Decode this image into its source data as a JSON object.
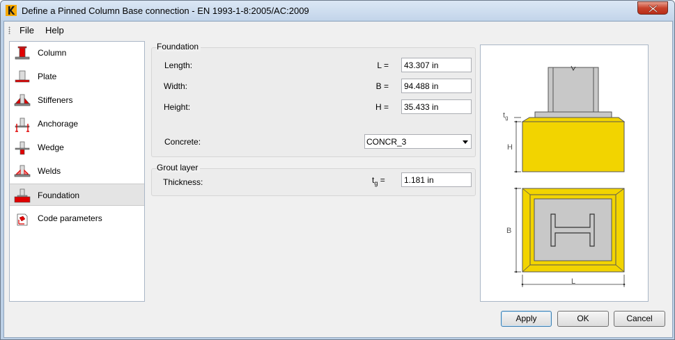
{
  "window": {
    "title": "Define a Pinned Column Base connection - EN 1993-1-8:2005/AC:2009"
  },
  "menu": {
    "items": [
      {
        "label": "File"
      },
      {
        "label": "Help"
      }
    ]
  },
  "sidebar": {
    "items": [
      {
        "label": "Column",
        "icon": "column-icon",
        "active": false
      },
      {
        "label": "Plate",
        "icon": "plate-icon",
        "active": false
      },
      {
        "label": "Stiffeners",
        "icon": "stiffeners-icon",
        "active": false
      },
      {
        "label": "Anchorage",
        "icon": "anchorage-icon",
        "active": false
      },
      {
        "label": "Wedge",
        "icon": "wedge-icon",
        "active": false
      },
      {
        "label": "Welds",
        "icon": "welds-icon",
        "active": false
      },
      {
        "label": "Foundation",
        "icon": "foundation-icon",
        "active": true
      },
      {
        "label": "Code parameters",
        "icon": "code-parameters-icon",
        "active": false
      }
    ]
  },
  "foundation": {
    "title": "Foundation",
    "length": {
      "label": "Length:",
      "symbol": "L =",
      "value": "43.307 in"
    },
    "width": {
      "label": "Width:",
      "symbol": "B =",
      "value": "94.488 in"
    },
    "height": {
      "label": "Height:",
      "symbol": "H =",
      "value": "35.433 in"
    },
    "concrete": {
      "label": "Concrete:",
      "value": "CONCR_3"
    }
  },
  "grout": {
    "title": "Grout layer",
    "thickness": {
      "label": "Thickness:",
      "symbol_main": "t",
      "symbol_sub": "g",
      "symbol_suffix": " =",
      "value": "1.181 in"
    }
  },
  "preview": {
    "tg_main": "t",
    "tg_sub": "g",
    "h_label": "H",
    "b_label": "B",
    "l_label": "L"
  },
  "buttons": {
    "apply": "Apply",
    "ok": "OK",
    "cancel": "Cancel"
  },
  "colors": {
    "concrete": "#f2d400",
    "steel": "#c8c8c8",
    "accent_red": "#e00000"
  }
}
